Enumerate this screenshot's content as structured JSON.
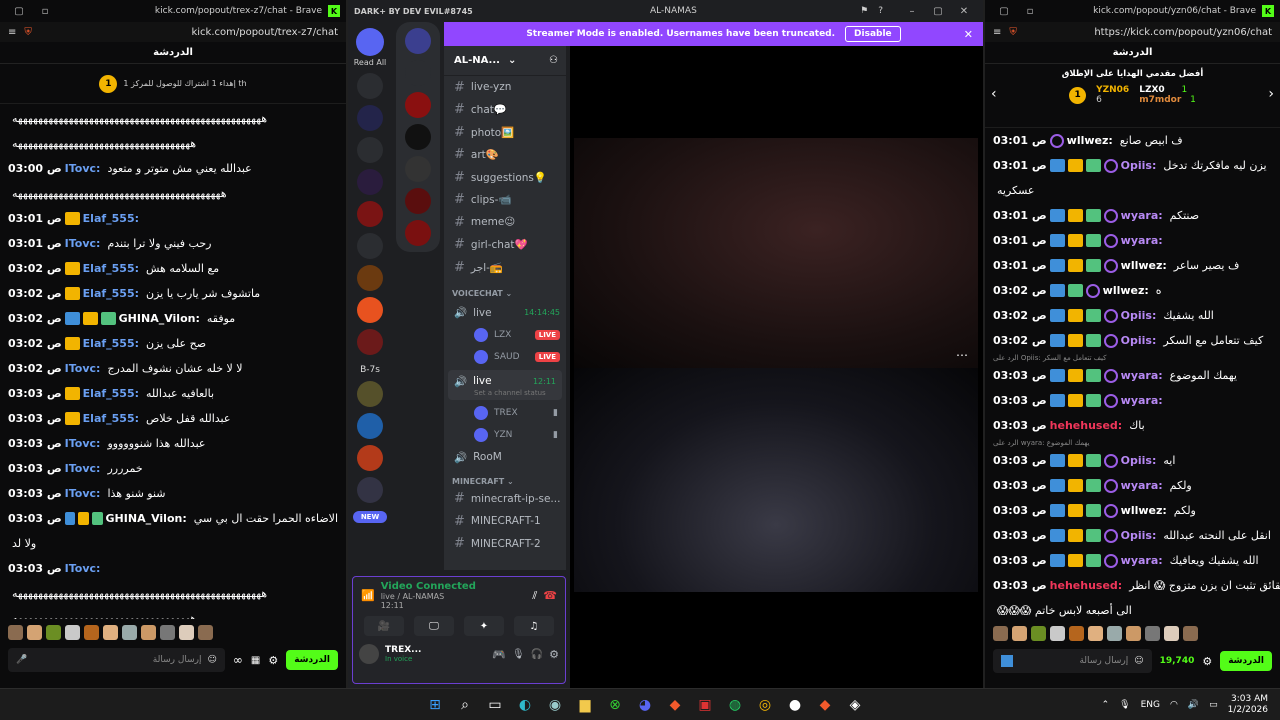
{
  "left": {
    "window_title": "kick.com/popout/trex-z7/chat - Brave",
    "url": "kick.com/popout/trex-z7/chat",
    "header": "الدردشة",
    "goal_text": "إهداء 1 اشتراك للوصول للمركز 1 th",
    "goal_rank": "1",
    "messages": [
      {
        "time": "",
        "user": "",
        "text": "هههههههههههههههههههههههههههههههههههههههههههههههههه",
        "ucls": "u-white",
        "badges": []
      },
      {
        "time": "",
        "user": "",
        "text": "هههههههههههههههههههههههههههههههههههه",
        "ucls": "u-white",
        "badges": []
      },
      {
        "time": "03:00 ص",
        "user": "ITovc:",
        "text": "عبدالله يعني مش متوتر و متعود",
        "ucls": "u-blue",
        "badges": []
      },
      {
        "time": "",
        "user": "",
        "text": "هههههههههههههههههههههههههههههههههههههههههه",
        "ucls": "u-white",
        "badges": []
      },
      {
        "time": "03:01 ص",
        "user": "Elaf_555:",
        "text": "",
        "ucls": "u-blue",
        "badges": [
          "b-gold"
        ]
      },
      {
        "time": "03:01 ص",
        "user": "ITovc:",
        "text": "رحب فيني ولا ترا بتندم",
        "ucls": "u-blue",
        "badges": []
      },
      {
        "time": "03:02 ص",
        "user": "Elaf_555:",
        "text": "مع السلامه هش",
        "ucls": "u-blue",
        "badges": [
          "b-gold"
        ]
      },
      {
        "time": "03:02 ص",
        "user": "Elaf_555:",
        "text": "ماتشوف شر يارب يا يزن",
        "ucls": "u-blue",
        "badges": [
          "b-gold"
        ]
      },
      {
        "time": "03:02 ص",
        "user": "GHINA_Vilon:",
        "text": "موفقه",
        "ucls": "u-white",
        "badges": [
          "b-blue",
          "b-gold",
          "b-green"
        ]
      },
      {
        "time": "03:02 ص",
        "user": "Elaf_555:",
        "text": "صح على يزن",
        "ucls": "u-blue",
        "badges": [
          "b-gold"
        ]
      },
      {
        "time": "03:02 ص",
        "user": "ITovc:",
        "text": "لا لا خله عشان نشوف المدرج",
        "ucls": "u-blue",
        "badges": []
      },
      {
        "time": "03:03 ص",
        "user": "Elaf_555:",
        "text": "بالعافيه عبدالله",
        "ucls": "u-blue",
        "badges": [
          "b-gold"
        ]
      },
      {
        "time": "03:03 ص",
        "user": "Elaf_555:",
        "text": "عبدالله قفل خلاص",
        "ucls": "u-blue",
        "badges": [
          "b-gold"
        ]
      },
      {
        "time": "03:03 ص",
        "user": "ITovc:",
        "text": "عبدالله هذا شنوووووو",
        "ucls": "u-blue",
        "badges": []
      },
      {
        "time": "03:03 ص",
        "user": "ITovc:",
        "text": "خمرررر",
        "ucls": "u-blue",
        "badges": []
      },
      {
        "time": "03:03 ص",
        "user": "ITovc:",
        "text": "شنو شنو هذا",
        "ucls": "u-blue",
        "badges": []
      },
      {
        "time": "03:03 ص",
        "user": "GHINA_Vilon:",
        "text": "الاضاءه الحمرا حقت ال بي سي",
        "ucls": "u-white",
        "badges": [
          "b-blue",
          "b-gold",
          "b-green"
        ]
      },
      {
        "time": "",
        "user": "",
        "text": "ولا لد",
        "ucls": "u-white",
        "badges": []
      },
      {
        "time": "03:03 ص",
        "user": "ITovc:",
        "text": "",
        "ucls": "u-blue",
        "badges": []
      },
      {
        "time": "",
        "user": "",
        "text": "هههههههههههههههههههههههههههههههههههههههههههههههههه",
        "ucls": "u-white",
        "badges": []
      },
      {
        "time": "",
        "user": "",
        "text": "هههههههههههههههههههههههههههههههههههه",
        "ucls": "u-white",
        "badges": []
      }
    ],
    "input_placeholder": "إرسال رسالة",
    "chat_button": "الدردشة"
  },
  "discord": {
    "title": "AL-NAMAS",
    "brand": "DARK+ BY DEV EVIL#8745",
    "banner": "Streamer Mode is enabled. Usernames have been truncated.",
    "disable": "Disable",
    "read_all": "Read All",
    "server_name": "AL-NA...",
    "channels": [
      "live-yzn",
      "chat💬",
      "photo🖼️",
      "art🎨",
      "suggestions💡",
      "clips-📹",
      "meme😉",
      "girl-chat💖",
      "اجر-📻"
    ],
    "voice_category": "VOICECHAT",
    "voice_live": "live",
    "voice_live_time": "14:14:45",
    "voice_users1": [
      {
        "name": "LZX",
        "live": "LIVE"
      },
      {
        "name": "SAUD",
        "live": "LIVE"
      }
    ],
    "voice_live2": "live",
    "voice_live2_time": "12:11",
    "voice_status": "Set a channel status",
    "voice_users2": [
      {
        "name": "TREX"
      },
      {
        "name": "YZN"
      }
    ],
    "room": "RooM",
    "mc_category": "MINECRAFT",
    "mc_channels": [
      "minecraft-ip-se...",
      "MINECRAFT-1",
      "MINECRAFT-2"
    ],
    "server_labels": [
      "B-7s",
      "NEW"
    ],
    "vc_title": "Video Connected",
    "vc_sub": "live / AL-NAMAS",
    "vc_time": "12:11",
    "user_name": "TREX...",
    "user_status": "In voice"
  },
  "right": {
    "window_title": "kick.com/popout/yzn06/chat - Brave",
    "url": "https://kick.com/popout/yzn06/chat",
    "header": "الدردشة",
    "top_title": "أفضل مقدمي الهدايا على الإطلاق",
    "top": [
      {
        "rank": "1",
        "name": "YZN06",
        "count": "6"
      },
      {
        "name": "LZX0",
        "count": "1"
      },
      {
        "name": "m7mdor",
        "count": "1"
      }
    ],
    "messages": [
      {
        "time": "03:01 ص",
        "user": "wllwez:",
        "text": "ف ابيص صانع",
        "ucls": "u-white",
        "badges": [
          "b-purple"
        ],
        "reply": ""
      },
      {
        "time": "03:01 ص",
        "user": "Opiis:",
        "text": "يزن ليه مافكرتك تدخل",
        "ucls": "u-purple",
        "badges": [
          "b-blue",
          "b-gold",
          "b-green",
          "b-purple"
        ],
        "reply": ""
      },
      {
        "time": "",
        "user": "",
        "text": "عسكريه",
        "ucls": "u-white",
        "badges": [],
        "reply": ""
      },
      {
        "time": "03:01 ص",
        "user": "wyara:",
        "text": "صنتكم",
        "ucls": "u-purple",
        "badges": [
          "b-blue",
          "b-gold",
          "b-green",
          "b-purple"
        ],
        "reply": ""
      },
      {
        "time": "03:01 ص",
        "user": "wyara:",
        "text": "",
        "ucls": "u-purple",
        "badges": [
          "b-blue",
          "b-gold",
          "b-green",
          "b-purple"
        ],
        "reply": ""
      },
      {
        "time": "03:01 ص",
        "user": "wllwez:",
        "text": "ف يصير ساعر",
        "ucls": "u-white",
        "badges": [
          "b-blue",
          "b-gold",
          "b-green",
          "b-purple"
        ],
        "reply": ""
      },
      {
        "time": "03:02 ص",
        "user": "wllwez:",
        "text": "ه",
        "ucls": "u-white",
        "badges": [
          "b-blue",
          "b-green",
          "b-purple"
        ],
        "reply": ""
      },
      {
        "time": "03:02 ص",
        "user": "Opiis:",
        "text": "الله يشفيك",
        "ucls": "u-purple",
        "badges": [
          "b-blue",
          "b-gold",
          "b-green",
          "b-purple"
        ],
        "reply": ""
      },
      {
        "time": "03:02 ص",
        "user": "Opiis:",
        "text": "كيف تتعامل مع السكر",
        "ucls": "u-purple",
        "badges": [
          "b-blue",
          "b-gold",
          "b-green",
          "b-purple"
        ],
        "reply": ""
      },
      {
        "time": "03:03 ص",
        "user": "wyara:",
        "text": "يهمك الموضوع",
        "ucls": "u-purple",
        "badges": [
          "b-blue",
          "b-gold",
          "b-green",
          "b-purple"
        ],
        "reply": "الرد على Opiis: كيف تتعامل مع السكر"
      },
      {
        "time": "03:03 ص",
        "user": "wyara:",
        "text": "",
        "ucls": "u-purple",
        "badges": [
          "b-blue",
          "b-gold",
          "b-green",
          "b-purple"
        ],
        "reply": ""
      },
      {
        "time": "03:03 ص",
        "user": "hehehused:",
        "text": "باك",
        "ucls": "u-red",
        "badges": [],
        "reply": ""
      },
      {
        "time": "03:03 ص",
        "user": "Opiis:",
        "text": "ايه",
        "ucls": "u-purple",
        "badges": [
          "b-blue",
          "b-gold",
          "b-green",
          "b-purple"
        ],
        "reply": "الرد على wyara: يهمك الموضوع"
      },
      {
        "time": "03:03 ص",
        "user": "wyara:",
        "text": "ولكم",
        "ucls": "u-purple",
        "badges": [
          "b-blue",
          "b-gold",
          "b-green",
          "b-purple"
        ],
        "reply": ""
      },
      {
        "time": "03:03 ص",
        "user": "wllwez:",
        "text": "ولكم",
        "ucls": "u-white",
        "badges": [
          "b-blue",
          "b-gold",
          "b-green",
          "b-purple"
        ],
        "reply": ""
      },
      {
        "time": "03:03 ص",
        "user": "Opiis:",
        "text": "انقل على النحته عبدالله",
        "ucls": "u-purple",
        "badges": [
          "b-blue",
          "b-gold",
          "b-green",
          "b-purple"
        ],
        "reply": ""
      },
      {
        "time": "03:03 ص",
        "user": "wyara:",
        "text": "الله يشفيك ويعافيك",
        "ucls": "u-purple",
        "badges": [
          "b-blue",
          "b-gold",
          "b-green",
          "b-purple"
        ],
        "reply": ""
      },
      {
        "time": "03:03 ص",
        "user": "hehehused:",
        "text": "حقائق تثبت ان يزن متزوج 😱 انظر",
        "ucls": "u-red",
        "badges": [],
        "reply": ""
      },
      {
        "time": "",
        "user": "",
        "text": "الى أصبعه لابس خاتم 😱😱😱",
        "ucls": "u-white",
        "badges": [],
        "reply": ""
      }
    ],
    "input_placeholder": "إرسال رسالة",
    "points": "19,740",
    "chat_button": "الدردشة"
  },
  "taskbar": {
    "lang": "ENG",
    "time": "3:03 AM",
    "date": "1/2/2026"
  },
  "colors": {
    "kick_green": "#53fc18",
    "discord_accent": "#5865f2",
    "banner": "#9147ff"
  }
}
